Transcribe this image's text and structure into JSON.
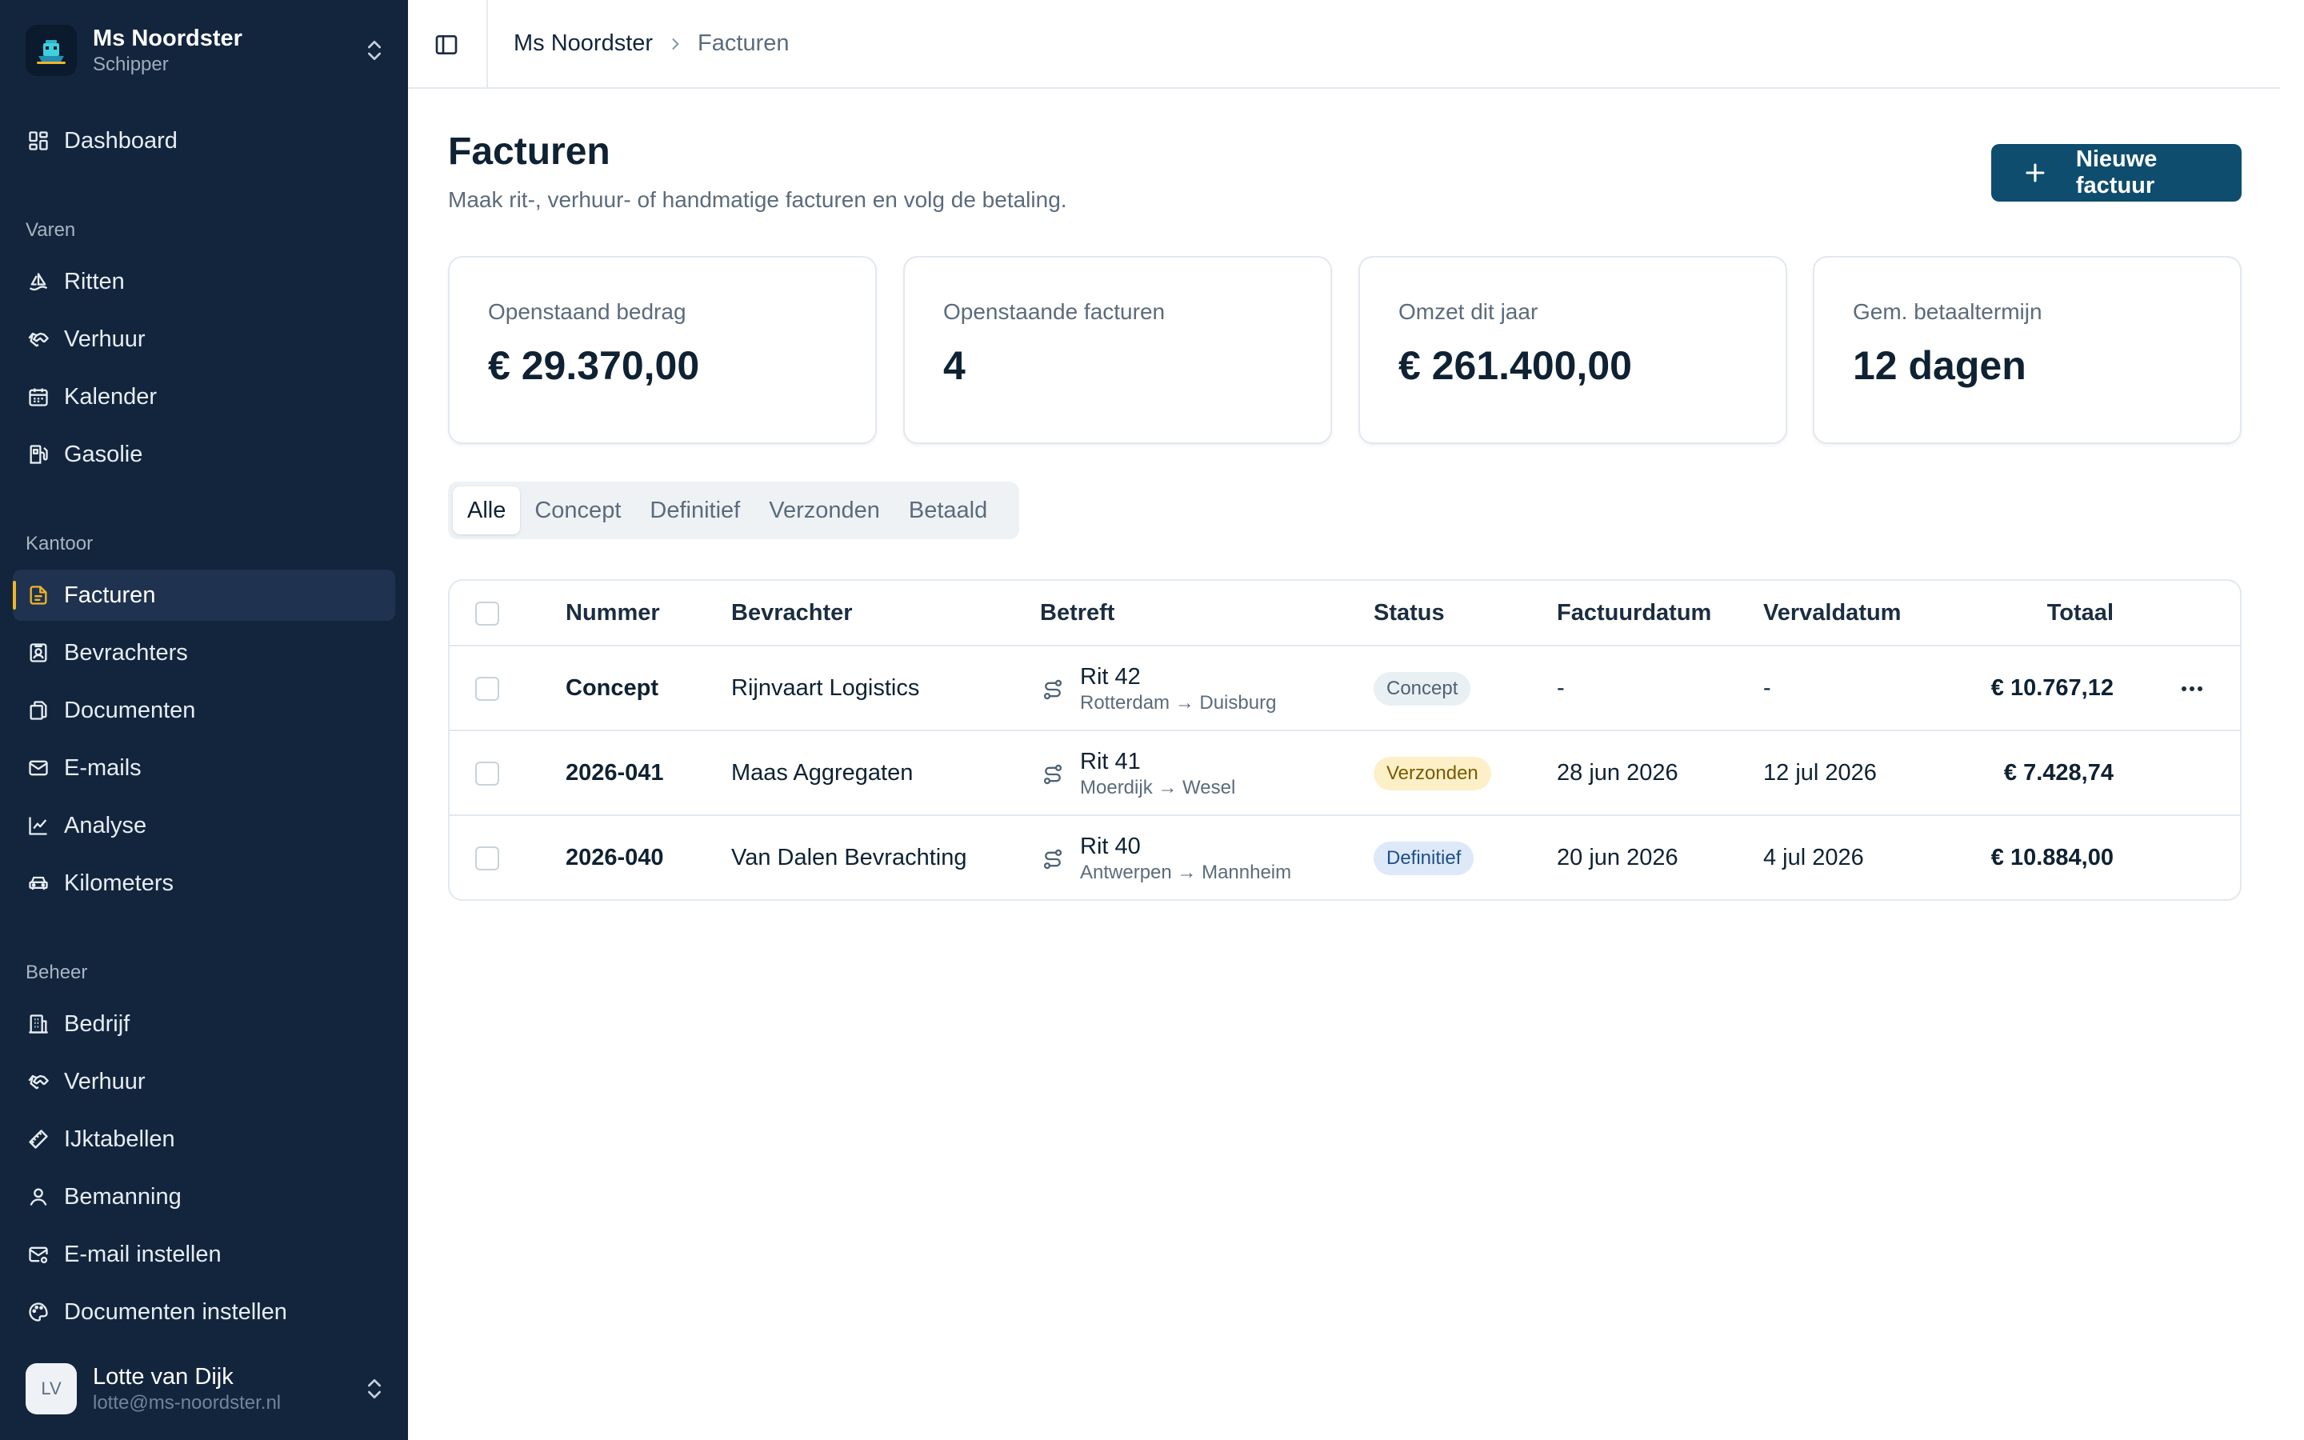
{
  "workspace": {
    "name": "Ms Noordster",
    "role": "Schipper"
  },
  "nav": {
    "dashboard": "Dashboard",
    "sections": {
      "varen": "Varen",
      "kantoor": "Kantoor",
      "beheer": "Beheer"
    },
    "varen": [
      "Ritten",
      "Verhuur",
      "Kalender",
      "Gasolie"
    ],
    "kantoor": [
      "Facturen",
      "Bevrachters",
      "Documenten",
      "E-mails",
      "Analyse",
      "Kilometers"
    ],
    "beheer": [
      "Bedrijf",
      "Verhuur",
      "IJktabellen",
      "Bemanning",
      "E-mail instellen",
      "Documenten instellen"
    ],
    "active": "Facturen"
  },
  "user": {
    "initials": "LV",
    "name": "Lotte van Dijk",
    "email": "lotte@ms-noordster.nl"
  },
  "breadcrumb": {
    "root": "Ms Noordster",
    "current": "Facturen"
  },
  "page": {
    "title": "Facturen",
    "subtitle": "Maak rit-, verhuur- of handmatige facturen en volg de betaling.",
    "new_button": "Nieuwe factuur"
  },
  "stats": [
    {
      "label": "Openstaand bedrag",
      "value": "€ 29.370,00"
    },
    {
      "label": "Openstaande facturen",
      "value": "4"
    },
    {
      "label": "Omzet dit jaar",
      "value": "€ 261.400,00"
    },
    {
      "label": "Gem. betaaltermijn",
      "value": "12 dagen"
    }
  ],
  "tabs": [
    "Alle",
    "Concept",
    "Definitief",
    "Verzonden",
    "Betaald"
  ],
  "active_tab": "Alle",
  "table": {
    "headers": {
      "nummer": "Nummer",
      "bevrachter": "Bevrachter",
      "betreft": "Betreft",
      "status": "Status",
      "factuurdatum": "Factuurdatum",
      "vervaldatum": "Vervaldatum",
      "totaal": "Totaal"
    },
    "rows": [
      {
        "nummer": "Concept",
        "bevrachter": "Rijnvaart Logistics",
        "rit": "Rit 42",
        "route": "Rotterdam → Duisburg",
        "status": "Concept",
        "factuurdatum": "-",
        "vervaldatum": "-",
        "totaal": "€ 10.767,12"
      },
      {
        "nummer": "2026-041",
        "bevrachter": "Maas Aggregaten",
        "rit": "Rit 41",
        "route": "Moerdijk → Wesel",
        "status": "Verzonden",
        "factuurdatum": "28 jun 2026",
        "vervaldatum": "12 jul 2026",
        "totaal": "€ 7.428,74"
      },
      {
        "nummer": "2026-040",
        "bevrachter": "Van Dalen Bevrachting",
        "rit": "Rit 40",
        "route": "Antwerpen → Mannheim",
        "status": "Definitief",
        "factuurdatum": "20 jun 2026",
        "vervaldatum": "4 jul 2026",
        "totaal": "€ 10.884,00"
      }
    ]
  },
  "colors": {
    "sidebar_bg": "#13253d",
    "accent": "#f0b429",
    "primary_button": "#0e4d6e"
  }
}
